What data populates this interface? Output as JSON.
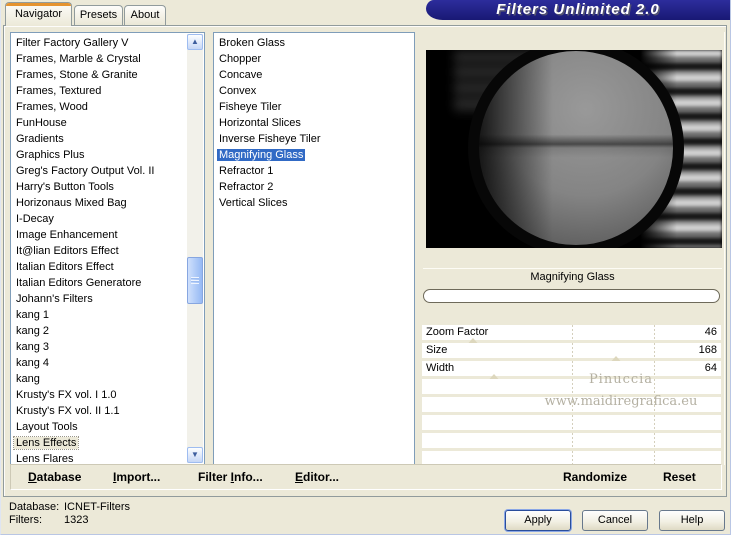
{
  "window": {
    "title": "Filters Unlimited 2.0"
  },
  "tabs": [
    {
      "label": "Navigator",
      "active": true
    },
    {
      "label": "Presets",
      "active": false
    },
    {
      "label": "About",
      "active": false
    }
  ],
  "category_list": {
    "selected": "Lens Effects",
    "items": [
      "Filter Factory Gallery V",
      "Frames, Marble & Crystal",
      "Frames, Stone & Granite",
      "Frames, Textured",
      "Frames, Wood",
      "FunHouse",
      "Gradients",
      "Graphics Plus",
      "Greg's Factory Output Vol. II",
      "Harry's Button Tools",
      "Horizonaus Mixed Bag",
      "I-Decay",
      "Image Enhancement",
      "It@lian Editors Effect",
      "Italian Editors Effect",
      "Italian Editors Generatore",
      "Johann's Filters",
      "kang 1",
      "kang 2",
      "kang 3",
      "kang 4",
      "kang",
      "Krusty's FX vol. I 1.0",
      "Krusty's FX vol. II 1.1",
      "Layout Tools",
      "Lens Effects",
      "Lens Flares"
    ]
  },
  "filter_list": {
    "selected": "Magnifying Glass",
    "items": [
      "Broken Glass",
      "Chopper",
      "Concave",
      "Convex",
      "Fisheye Tiler",
      "Horizontal Slices",
      "Inverse Fisheye Tiler",
      "Magnifying Glass",
      "Refractor 1",
      "Refractor 2",
      "Vertical Slices"
    ]
  },
  "controls": {
    "header": "Magnifying Glass",
    "sliders": [
      {
        "label": "Zoom Factor",
        "value": "46",
        "thumb_pct": 17
      },
      {
        "label": "Size",
        "value": "168",
        "thumb_pct": 65
      },
      {
        "label": "Width",
        "value": "64",
        "thumb_pct": 24
      }
    ],
    "empty_rows": 5
  },
  "watermark": {
    "line1": "Pinuccia",
    "line2": "www.maidiregrafica.eu"
  },
  "toolbar": {
    "buttons": [
      {
        "label": "Database",
        "accel": 0
      },
      {
        "label": "Import...",
        "accel": 0
      },
      {
        "label": "Filter Info...",
        "accel": 7
      },
      {
        "label": "Editor...",
        "accel": 0
      },
      {
        "label": "Randomize",
        "accel": -1
      },
      {
        "label": "Reset",
        "accel": -1
      }
    ]
  },
  "footer": {
    "database_label": "Database:",
    "database_value": "ICNET-Filters",
    "filters_label": "Filters:",
    "filters_value": "1323",
    "apply": "Apply",
    "cancel": "Cancel",
    "help": "Help"
  },
  "colors": {
    "background": "#ece9d8",
    "selection": "#316ac5",
    "banner": "#1c1c80",
    "tab_accent": "#e5932f"
  }
}
